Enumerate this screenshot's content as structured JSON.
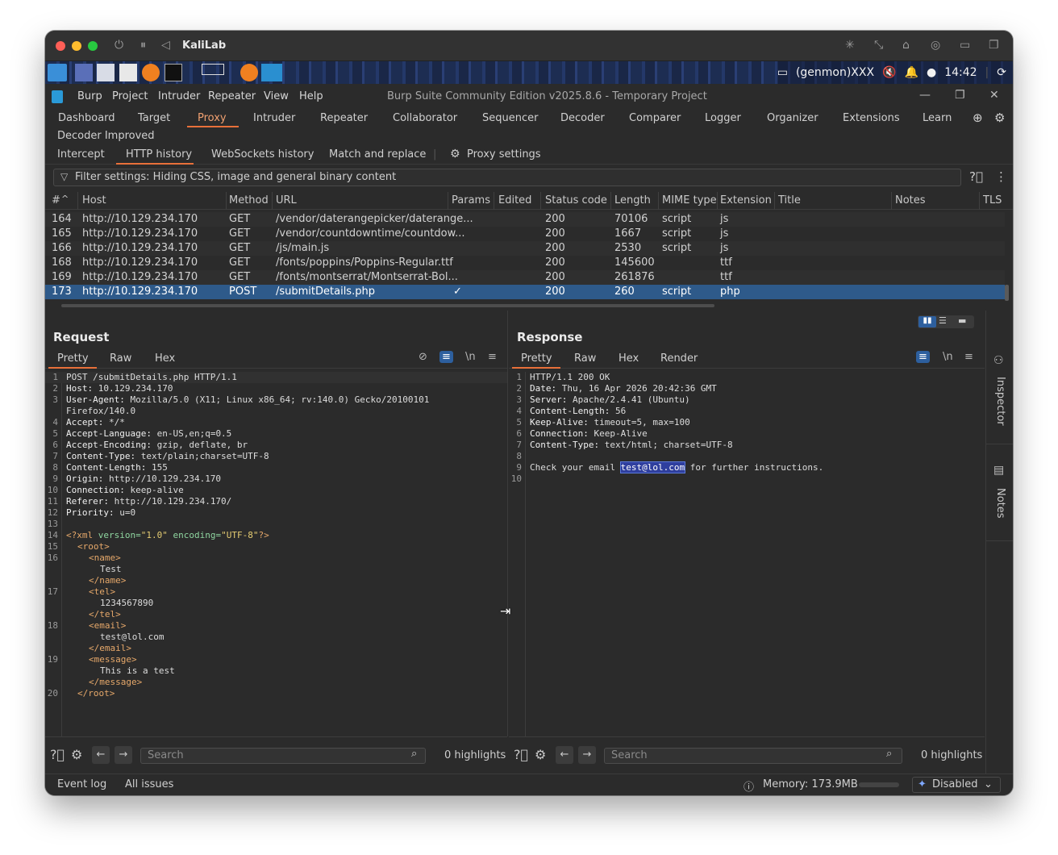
{
  "vm": {
    "title": "KaliLab"
  },
  "kali": {
    "user": "(genmon)XXX",
    "clock": "14:42"
  },
  "burp": {
    "menu": [
      "Burp",
      "Project",
      "Intruder",
      "Repeater",
      "View",
      "Help"
    ],
    "window_title": "Burp Suite Community Edition v2025.8.6 - Temporary Project",
    "tabs": [
      "Dashboard",
      "Target",
      "Proxy",
      "Intruder",
      "Repeater",
      "Collaborator",
      "Sequencer",
      "Decoder",
      "Comparer",
      "Logger",
      "Organizer",
      "Extensions",
      "Learn"
    ],
    "extra_tab": "Decoder Improved",
    "selected_tab": "Proxy",
    "subtabs": [
      "Intercept",
      "HTTP history",
      "WebSockets history",
      "Match and replace"
    ],
    "proxy_settings": "Proxy settings",
    "filter": "Filter settings: Hiding CSS, image and general binary content"
  },
  "table": {
    "headers": [
      "#",
      "Host",
      "Method",
      "URL",
      "Params",
      "Edited",
      "Status code",
      "Length",
      "MIME type",
      "Extension",
      "Title",
      "Notes",
      "TLS"
    ],
    "rows": [
      {
        "id": "164",
        "host": "http://10.129.234.170",
        "method": "GET",
        "url": "/vendor/daterangepicker/daterange...",
        "params": "",
        "status": "200",
        "length": "70106",
        "mime": "script",
        "ext": "js"
      },
      {
        "id": "165",
        "host": "http://10.129.234.170",
        "method": "GET",
        "url": "/vendor/countdowntime/countdow...",
        "params": "",
        "status": "200",
        "length": "1667",
        "mime": "script",
        "ext": "js"
      },
      {
        "id": "166",
        "host": "http://10.129.234.170",
        "method": "GET",
        "url": "/js/main.js",
        "params": "",
        "status": "200",
        "length": "2530",
        "mime": "script",
        "ext": "js"
      },
      {
        "id": "168",
        "host": "http://10.129.234.170",
        "method": "GET",
        "url": "/fonts/poppins/Poppins-Regular.ttf",
        "params": "",
        "status": "200",
        "length": "145600",
        "mime": "",
        "ext": "ttf"
      },
      {
        "id": "169",
        "host": "http://10.129.234.170",
        "method": "GET",
        "url": "/fonts/montserrat/Montserrat-Bol...",
        "params": "",
        "status": "200",
        "length": "261876",
        "mime": "",
        "ext": "ttf"
      },
      {
        "id": "173",
        "host": "http://10.129.234.170",
        "method": "POST",
        "url": "/submitDetails.php",
        "params": "✓",
        "status": "200",
        "length": "260",
        "mime": "script",
        "ext": "php"
      }
    ]
  },
  "request": {
    "title": "Request",
    "tabs": [
      "Pretty",
      "Raw",
      "Hex"
    ],
    "search_placeholder": "Search",
    "highlights": "0 highlights"
  },
  "response": {
    "title": "Response",
    "tabs": [
      "Pretty",
      "Raw",
      "Hex",
      "Render"
    ],
    "search_placeholder": "Search",
    "highlights": "0 highlights",
    "lines": [
      {
        "n": "1",
        "key": "",
        "val": "HTTP/1.1 200 OK"
      },
      {
        "n": "2",
        "key": "Date:",
        "val": " Thu, 16 Apr 2026 20:42:36 GMT"
      },
      {
        "n": "3",
        "key": "Server:",
        "val": " Apache/2.4.41 (Ubuntu)"
      },
      {
        "n": "4",
        "key": "Content-Length:",
        "val": " 56"
      },
      {
        "n": "5",
        "key": "Keep-Alive:",
        "val": " timeout=5, max=100"
      },
      {
        "n": "6",
        "key": "Connection:",
        "val": " Keep-Alive"
      },
      {
        "n": "7",
        "key": "Content-Type:",
        "val": " text/html; charset=UTF-8"
      },
      {
        "n": "8",
        "key": "",
        "val": ""
      },
      {
        "n": "9",
        "key": "",
        "val": "Check your email "
      },
      {
        "n": "10",
        "key": "",
        "val": ""
      }
    ],
    "email": "test@lol.com",
    "body_tail": " for further instructions."
  },
  "request_lines": [
    {
      "n": "1",
      "key": "",
      "val": "POST /submitDetails.php HTTP/1.1"
    },
    {
      "n": "2",
      "key": "Host:",
      "val": " 10.129.234.170"
    },
    {
      "n": "3",
      "key": "User-Agent:",
      "val": " Mozilla/5.0 (X11; Linux x86_64; rv:140.0) Gecko/20100101"
    },
    {
      "n": "",
      "key": "",
      "val": "Firefox/140.0"
    },
    {
      "n": "4",
      "key": "Accept:",
      "val": " */*"
    },
    {
      "n": "5",
      "key": "Accept-Language:",
      "val": " en-US,en;q=0.5"
    },
    {
      "n": "6",
      "key": "Accept-Encoding:",
      "val": " gzip, deflate, br"
    },
    {
      "n": "7",
      "key": "Content-Type:",
      "val": " text/plain;charset=UTF-8"
    },
    {
      "n": "8",
      "key": "Content-Length:",
      "val": " 155"
    },
    {
      "n": "9",
      "key": "Origin:",
      "val": " http://10.129.234.170"
    },
    {
      "n": "10",
      "key": "Connection:",
      "val": " keep-alive"
    },
    {
      "n": "11",
      "key": "Referer:",
      "val": " http://10.129.234.170/"
    },
    {
      "n": "12",
      "key": "Priority:",
      "val": " u=0"
    },
    {
      "n": "13",
      "key": "",
      "val": ""
    }
  ],
  "xml": {
    "decl_open": "<?xml ",
    "version_attr": "version=",
    "version_val": "\"1.0\"",
    "encoding_attr": " encoding=",
    "encoding_val": "\"UTF-8\"",
    "decl_close": "?>",
    "lines": [
      {
        "n": "15",
        "tag": "<root>",
        "text": ""
      },
      {
        "n": "16",
        "tag": "<name>",
        "text": ""
      },
      {
        "n": "",
        "tag": "",
        "text": "Test"
      },
      {
        "n": "",
        "tag": "</name>",
        "text": ""
      },
      {
        "n": "17",
        "tag": "<tel>",
        "text": ""
      },
      {
        "n": "",
        "tag": "",
        "text": "1234567890"
      },
      {
        "n": "",
        "tag": "</tel>",
        "text": ""
      },
      {
        "n": "18",
        "tag": "<email>",
        "text": ""
      },
      {
        "n": "",
        "tag": "",
        "text": "test@lol.com"
      },
      {
        "n": "",
        "tag": "</email>",
        "text": ""
      },
      {
        "n": "19",
        "tag": "<message>",
        "text": ""
      },
      {
        "n": "",
        "tag": "",
        "text": "This is a test"
      },
      {
        "n": "",
        "tag": "</message>",
        "text": ""
      },
      {
        "n": "20",
        "tag": "</root>",
        "text": ""
      }
    ]
  },
  "rail": {
    "inspector": "Inspector",
    "notes": "Notes"
  },
  "status": {
    "event_log": "Event log",
    "all_issues": "All issues",
    "memory": "Memory: 173.9MB",
    "ai": "Disabled"
  }
}
